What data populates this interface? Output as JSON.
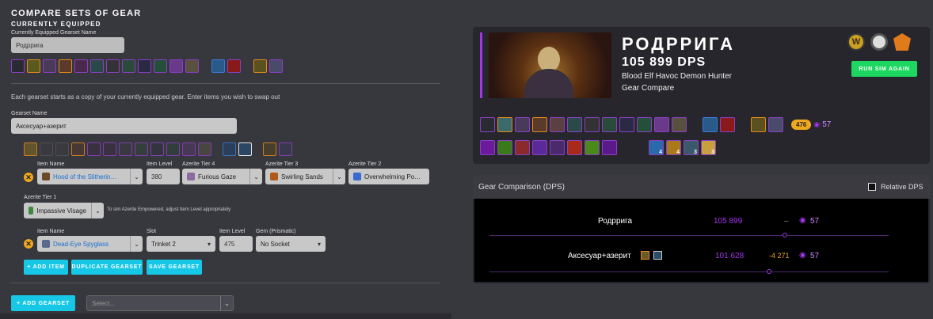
{
  "left": {
    "title": "COMPARE SETS OF GEAR",
    "equipped_title": "CURRENTLY EQUIPPED",
    "equipped_label": "Currently Equipped Gearset Name",
    "equipped_name": "Родррига",
    "info_text": "Each gearset starts as a copy of your currently equipped gear. Enter items you wish to swap out",
    "gearset_label": "Gearset Name",
    "gearset_name": "Аксесуар+азерит",
    "row1": {
      "item_label": "Item Name",
      "item_value": "Hood of the Slitherin…",
      "ilvl_label": "Item Level",
      "ilvl_value": "380",
      "t4_label": "Azerite Tier 4",
      "t4_value": "Furious Gaze",
      "t3_label": "Azerite Tier 3",
      "t3_value": "Swirling Sands",
      "t2_label": "Azerite Tier 2",
      "t2_value": "Overwhelming Po…",
      "t1_label": "Azerite Tier 1",
      "t1_value": "Impassive Visage",
      "hint": "To sim Azerite Empowered, adjust Item Level appropriately"
    },
    "row2": {
      "item_label": "Item Name",
      "item_value": "Dead-Eye Spyglass",
      "slot_label": "Slot",
      "slot_value": "Trinket 2",
      "ilvl_label": "Item Level",
      "ilvl_value": "475",
      "gem_label": "Gem (Prismatic)",
      "gem_value": "No Socket"
    },
    "buttons": {
      "add_item": "+ ADD ITEM",
      "duplicate": "DUPLICATE GEARSET",
      "save": "SAVE GEARSET",
      "add_gearset": "+ ADD GEARSET"
    },
    "select_placeholder": "Select..."
  },
  "sim": {
    "name": "РОДРРИГА",
    "dps": "105 899 DPS",
    "spec": "Blood Elf Havoc Demon Hunter",
    "type": "Gear Compare",
    "run_again": "RUN SIM AGAIN",
    "ilvl_badge": "476",
    "azerite_count": "57",
    "badge_numbers": [
      "4",
      "4",
      "3",
      "3"
    ]
  },
  "comparison": {
    "title": "Gear Comparison (DPS)",
    "relative_label": "Relative DPS",
    "rows": [
      {
        "name": "Родррига",
        "dps": "105 899",
        "diff": "–",
        "azerite": "57",
        "marker": 0.74
      },
      {
        "name": "Аксесуар+азерит",
        "dps": "101 628",
        "diff": "-4 271",
        "azerite": "57",
        "marker": 0.7
      }
    ]
  },
  "colors": {
    "accent": "#17c7e6",
    "purple": "#a335ee",
    "green": "#1ed760",
    "orange": "#f0a81c"
  }
}
